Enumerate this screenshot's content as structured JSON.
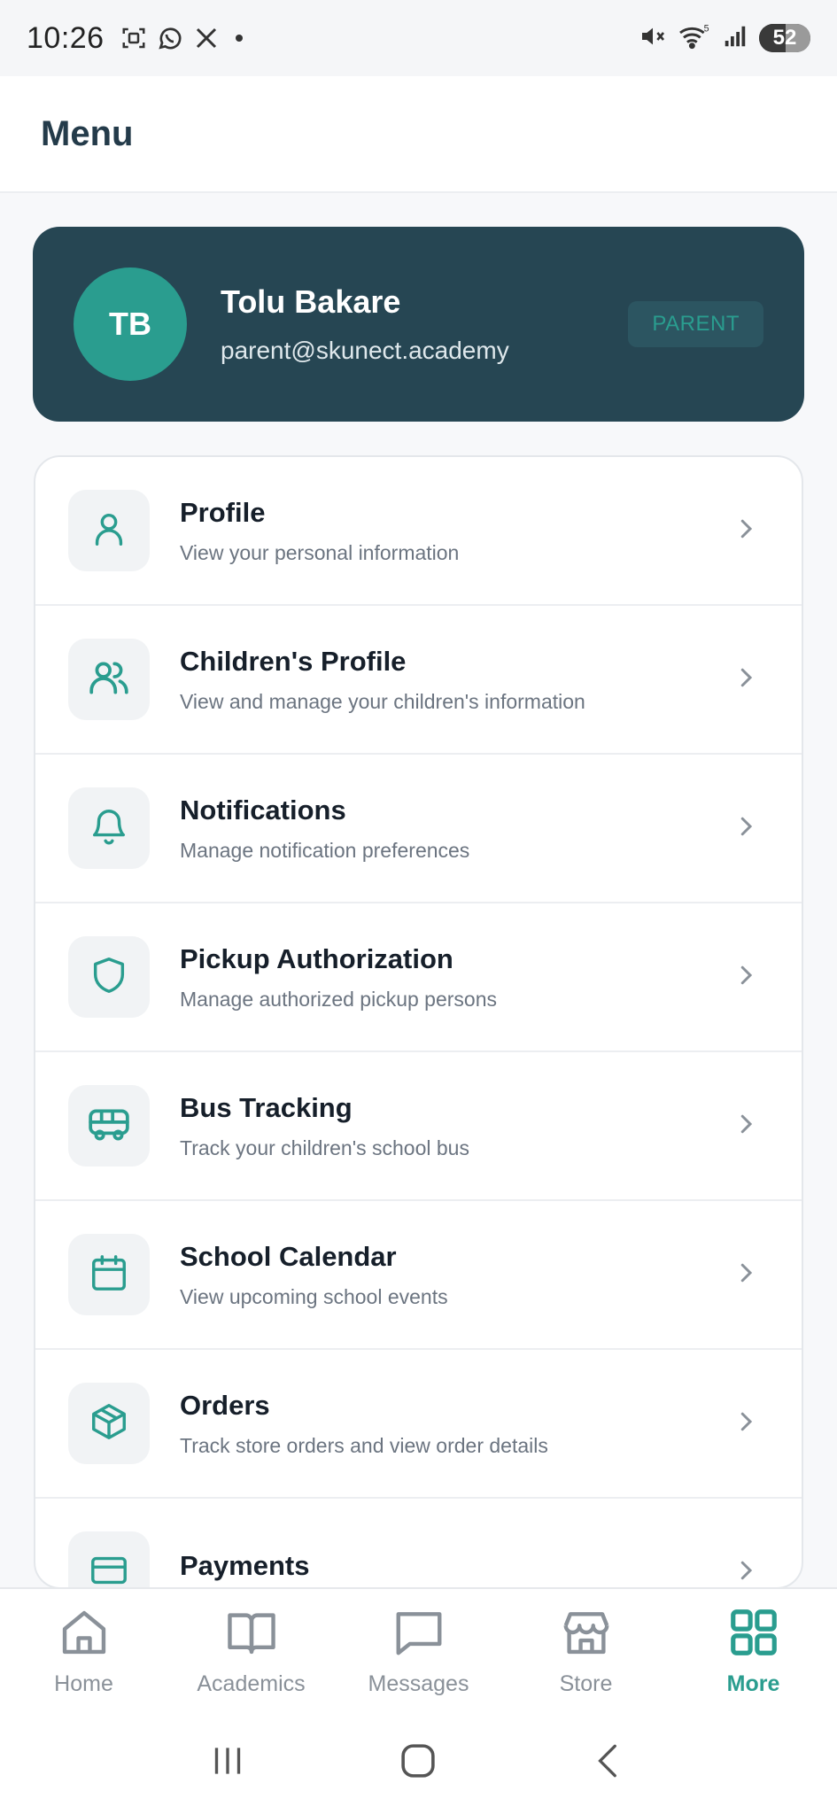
{
  "status_bar": {
    "time": "10:26",
    "battery": "52",
    "icons": [
      "screenshot-icon",
      "whatsapp-icon",
      "x-icon",
      "dot-icon",
      "mute-icon",
      "wifi-icon",
      "signal-icon",
      "battery-icon"
    ]
  },
  "header": {
    "title": "Menu"
  },
  "user": {
    "initials": "TB",
    "name": "Tolu Bakare",
    "email": "parent@skunect.academy",
    "role": "PARENT"
  },
  "menu": {
    "items": [
      {
        "title": "Profile",
        "subtitle": "View your personal information",
        "icon": "user-icon"
      },
      {
        "title": "Children's Profile",
        "subtitle": "View and manage your children's information",
        "icon": "users-icon"
      },
      {
        "title": "Notifications",
        "subtitle": "Manage notification preferences",
        "icon": "bell-icon"
      },
      {
        "title": "Pickup Authorization",
        "subtitle": "Manage authorized pickup persons",
        "icon": "shield-icon"
      },
      {
        "title": "Bus Tracking",
        "subtitle": "Track your children's school bus",
        "icon": "bus-icon"
      },
      {
        "title": "School Calendar",
        "subtitle": "View upcoming school events",
        "icon": "calendar-icon"
      },
      {
        "title": "Orders",
        "subtitle": "Track store orders and view order details",
        "icon": "package-icon"
      },
      {
        "title": "Payments",
        "subtitle": "",
        "icon": "credit-card-icon"
      }
    ]
  },
  "bottom_nav": {
    "items": [
      {
        "label": "Home",
        "icon": "home-icon"
      },
      {
        "label": "Academics",
        "icon": "book-icon"
      },
      {
        "label": "Messages",
        "icon": "message-icon"
      },
      {
        "label": "Store",
        "icon": "store-icon"
      },
      {
        "label": "More",
        "icon": "grid-icon",
        "active": true
      }
    ]
  },
  "colors": {
    "accent": "#2a9d8f",
    "card": "#264653",
    "title": "#243b4a"
  }
}
